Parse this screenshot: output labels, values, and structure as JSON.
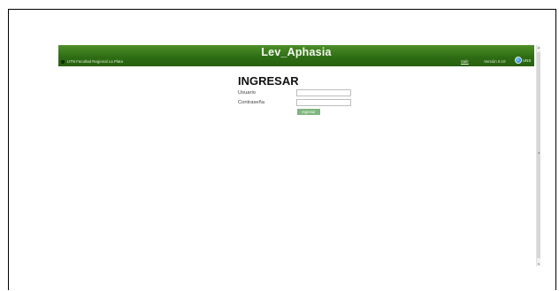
{
  "header": {
    "title": "Lev_Aphasia",
    "org_name": "UTN Facultad Regional La Plata",
    "logout_label": "Salir",
    "version": "Versión 0.10",
    "language_label": "UNS"
  },
  "login": {
    "title": "INGRESAR",
    "username_label": "Usuario",
    "password_label": "Contraseña",
    "username_value": "",
    "password_value": "",
    "submit_label": "Ingresar"
  },
  "icons": {
    "org": "org-logo-icon",
    "language": "globe-icon"
  },
  "colors": {
    "header_top": "#4d8f28",
    "header_bottom": "#27600f",
    "submit_bg": "#7fb57f"
  }
}
